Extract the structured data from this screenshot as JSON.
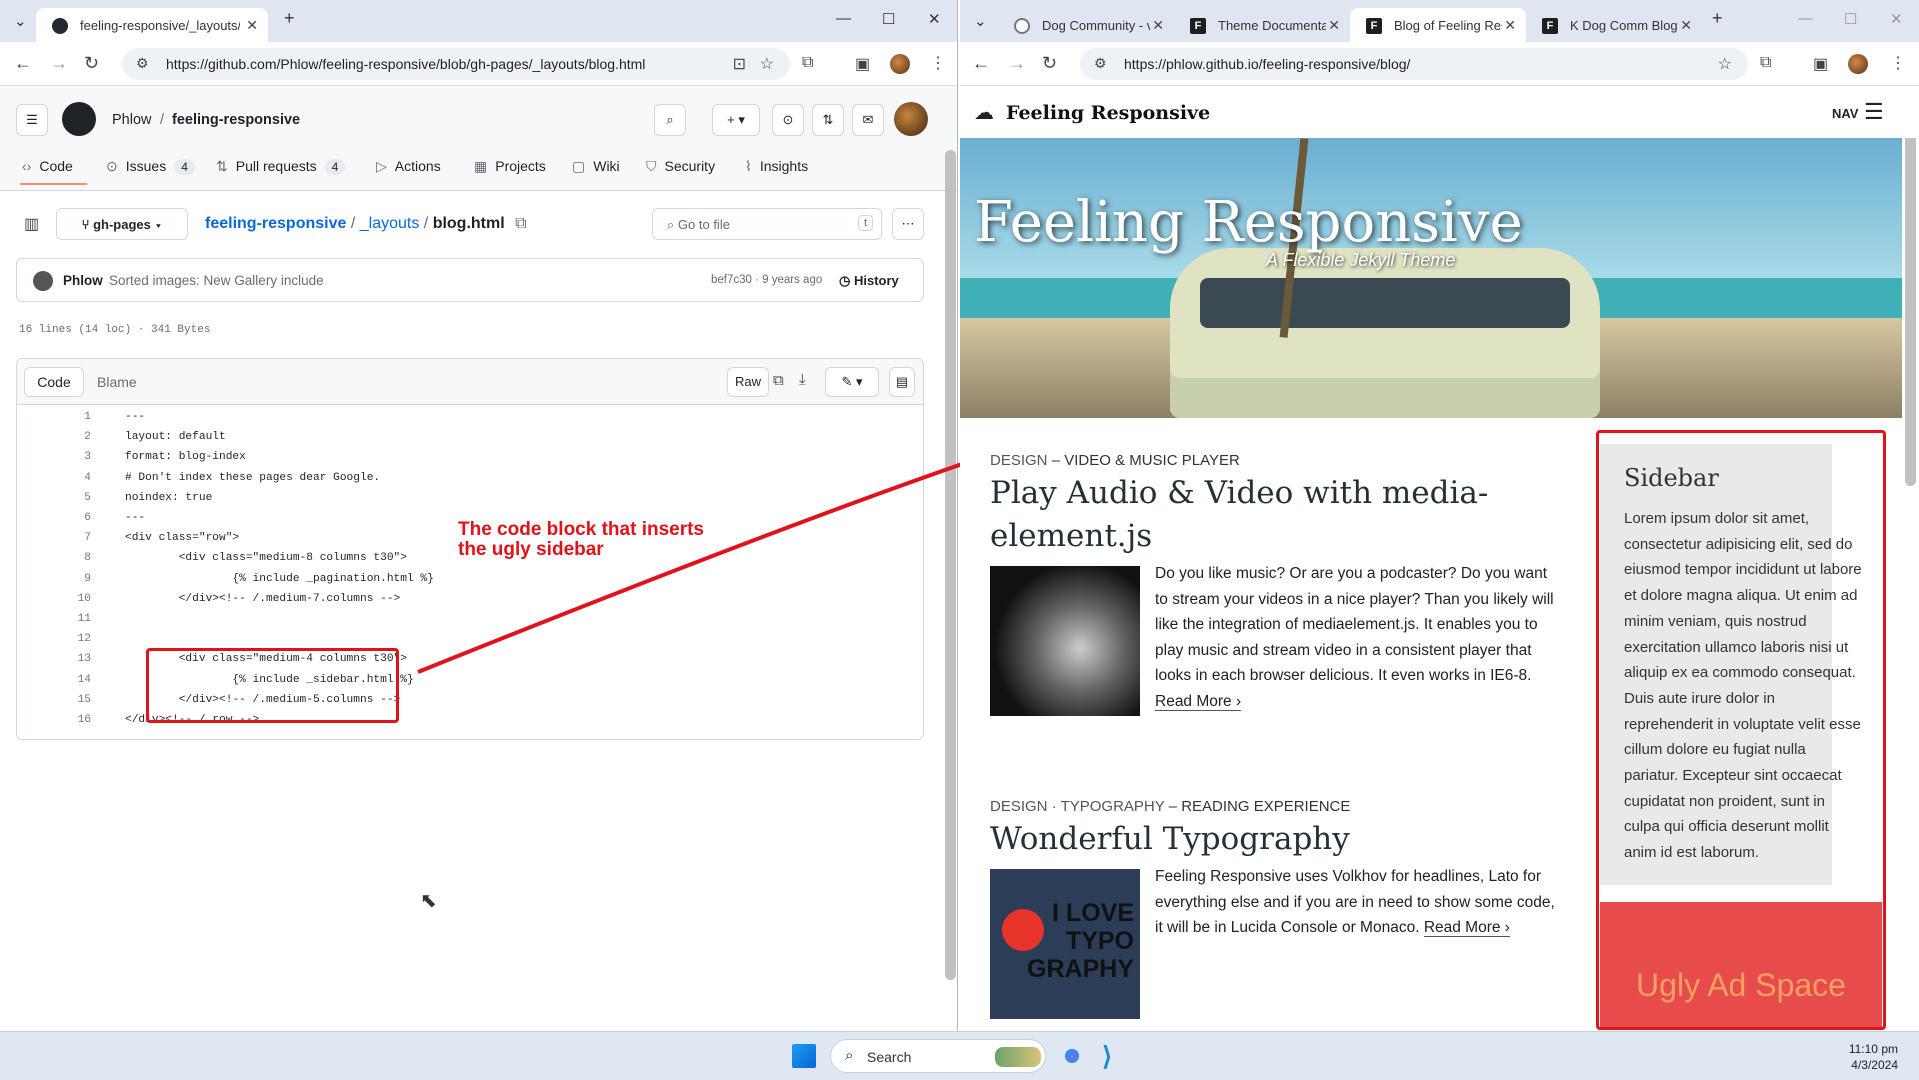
{
  "left_browser": {
    "tab_title": "feeling-responsive/_layouts/blo",
    "url": "https://github.com/Phlow/feeling-responsive/blob/gh-pages/_layouts/blog.html"
  },
  "github": {
    "owner": "Phlow",
    "repo": "feeling-responsive",
    "nav": [
      {
        "label": "Code",
        "count": ""
      },
      {
        "label": "Issues",
        "count": "4"
      },
      {
        "label": "Pull requests",
        "count": "4"
      },
      {
        "label": "Actions",
        "count": ""
      },
      {
        "label": "Projects",
        "count": ""
      },
      {
        "label": "Wiki",
        "count": ""
      },
      {
        "label": "Security",
        "count": ""
      },
      {
        "label": "Insights",
        "count": ""
      }
    ],
    "branch": "gh-pages",
    "path_repo": "feeling-responsive",
    "path_sep1": "/",
    "path_dir": "_layouts",
    "path_sep2": "/",
    "path_file": "blog.html",
    "goto_placeholder": "Go to file",
    "goto_key": "t",
    "commit_author": "Phlow",
    "commit_msg": "Sorted images: New Gallery include",
    "commit_hash": "bef7c30 · 9 years ago",
    "history": "History",
    "file_info": "16 lines (14 loc) · 341 Bytes",
    "view_code": "Code",
    "view_blame": "Blame",
    "raw": "Raw",
    "lines": [
      "---",
      "layout: default",
      "format: blog-index",
      "# Don't index these pages dear Google.",
      "noindex: true",
      "---",
      "<div class=\"row\">",
      "        <div class=\"medium-8 columns t30\">",
      "                {% include _pagination.html %}",
      "        </div><!-- /.medium-7.columns -->",
      "",
      "",
      "        <div class=\"medium-4 columns t30\">",
      "                {% include _sidebar.html %}",
      "        </div><!-- /.medium-5.columns -->",
      "</div><!-- /.row -->"
    ],
    "annotation": "The code block that inserts the ugly sidebar"
  },
  "right_browser": {
    "tabs": [
      "Dog Community - v",
      "Theme Documentat",
      "Blog of Feeling Res",
      "K Dog Comm Blog"
    ],
    "url": "https://phlow.github.io/feeling-responsive/blog/"
  },
  "site": {
    "brand": "Feeling Responsive",
    "nav_label": "NAV",
    "hero_title": "Feeling Responsive",
    "hero_subtitle": "A Flexible Jekyll Theme",
    "posts": [
      {
        "category": "DESIGN",
        "subtitle": "VIDEO & MUSIC PLAYER",
        "title": "Play Audio & Video with media-element.js",
        "text": "Do you like music? Or are you a podcaster? Do you want to stream your videos in a nice player? Than you likely will like the integration of mediaelement.js. It enables you to play music and stream video in a consistent player that looks in each browser delicious. It even works in IE6-8.",
        "more": "Read More ›"
      },
      {
        "category": "DESIGN · TYPOGRAPHY",
        "subtitle": "READING EXPERIENCE",
        "title": "Wonderful Typography",
        "text": "Feeling Responsive uses Volkhov for headlines, Lato for everything else and if you are in need to show some code, it will be in Lucida Console or Monaco.",
        "more": "Read More ›",
        "image_text": "I LOVE TYPO GRAPHY"
      }
    ],
    "sidebar_title": "Sidebar",
    "sidebar_text": "Lorem ipsum dolor sit amet, consectetur adipisicing elit, sed do eiusmod tempor incididunt ut labore et dolore magna aliqua. Ut enim ad minim veniam, quis nostrud exercitation ullamco laboris nisi ut aliquip ex ea commodo consequat. Duis aute irure dolor in reprehenderit in voluptate velit esse cillum dolore eu fugiat nulla pariatur. Excepteur sint occaecat cupidatat non proident, sunt in culpa qui officia deserunt mollit anim id est laborum.",
    "ad_text": "Ugly Ad Space"
  },
  "taskbar": {
    "search": "Search",
    "time": "11:10 pm",
    "date": "4/3/2024"
  },
  "colors": {
    "annotation_red": "#e0121a",
    "ad_red": "#e84b4b",
    "github_blue": "#0969da"
  }
}
